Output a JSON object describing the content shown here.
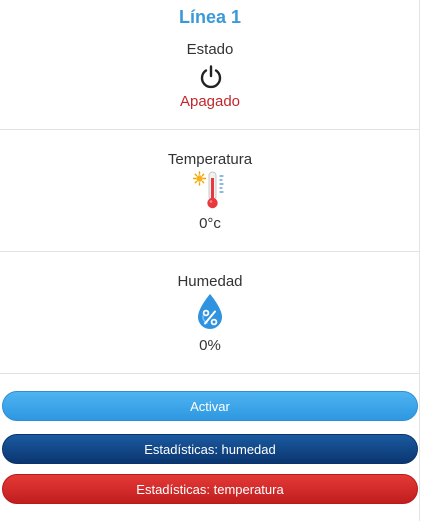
{
  "card": {
    "title": "Línea 1",
    "status": {
      "label": "Estado",
      "value": "Apagado",
      "icon": "power-icon"
    },
    "temperature": {
      "label": "Temperatura",
      "value": "0°c",
      "icon": "thermometer-sun-icon"
    },
    "humidity": {
      "label": "Humedad",
      "value": "0%",
      "icon": "humidity-drop-icon"
    }
  },
  "buttons": {
    "activate": "Activar",
    "stats_humidity": "Estadísticas: humedad",
    "stats_temperature": "Estadísticas: temperatura"
  },
  "colors": {
    "title": "#3a9ad9",
    "status_off": "#c0282d",
    "activate": "#2d98e1",
    "humidity_button": "#0b3670",
    "temperature_button": "#c11d1f"
  }
}
